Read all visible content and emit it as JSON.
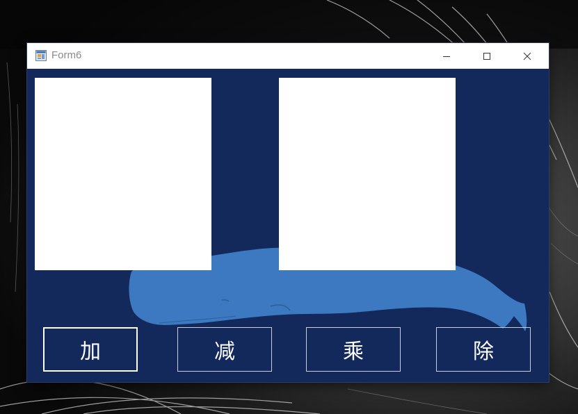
{
  "window": {
    "title": "Form6"
  },
  "icons": {
    "app": "form-app-icon",
    "minimize": "minimize-icon",
    "maximize": "maximize-icon",
    "close": "close-icon"
  },
  "buttons": {
    "add": "加",
    "subtract": "减",
    "multiply": "乘",
    "divide": "除"
  },
  "colors": {
    "form_background": "#13295c",
    "whale": "#3c79c0",
    "picture_box": "#ffffff",
    "button_text": "#ffffff",
    "title_text": "#8a8a8a"
  }
}
